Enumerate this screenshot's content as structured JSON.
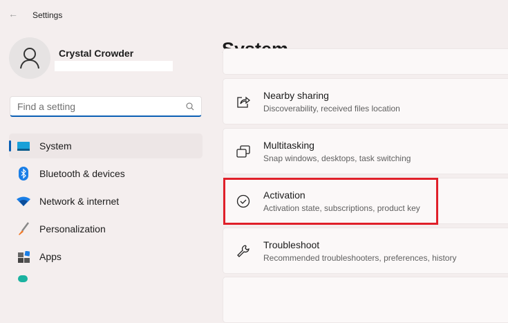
{
  "app": {
    "title": "Settings",
    "back_icon": "arrow-left-icon"
  },
  "user": {
    "name": "Crystal Crowder"
  },
  "search": {
    "placeholder": "Find a setting"
  },
  "sidebar": {
    "items": [
      {
        "label": "System",
        "selected": true
      },
      {
        "label": "Bluetooth & devices"
      },
      {
        "label": "Network & internet"
      },
      {
        "label": "Personalization"
      },
      {
        "label": "Apps"
      }
    ]
  },
  "main": {
    "title": "System",
    "items": [
      {
        "title": "Nearby sharing",
        "subtitle": "Discoverability, received files location",
        "icon": "share-icon"
      },
      {
        "title": "Multitasking",
        "subtitle": "Snap windows, desktops, task switching",
        "icon": "multitasking-icon"
      },
      {
        "title": "Activation",
        "subtitle": "Activation state, subscriptions, product key",
        "icon": "check-circle-icon",
        "highlighted": true
      },
      {
        "title": "Troubleshoot",
        "subtitle": "Recommended troubleshooters, preferences, history",
        "icon": "wrench-icon"
      }
    ]
  },
  "colors": {
    "accent": "#0a5fb4",
    "highlight": "#e0202a"
  }
}
